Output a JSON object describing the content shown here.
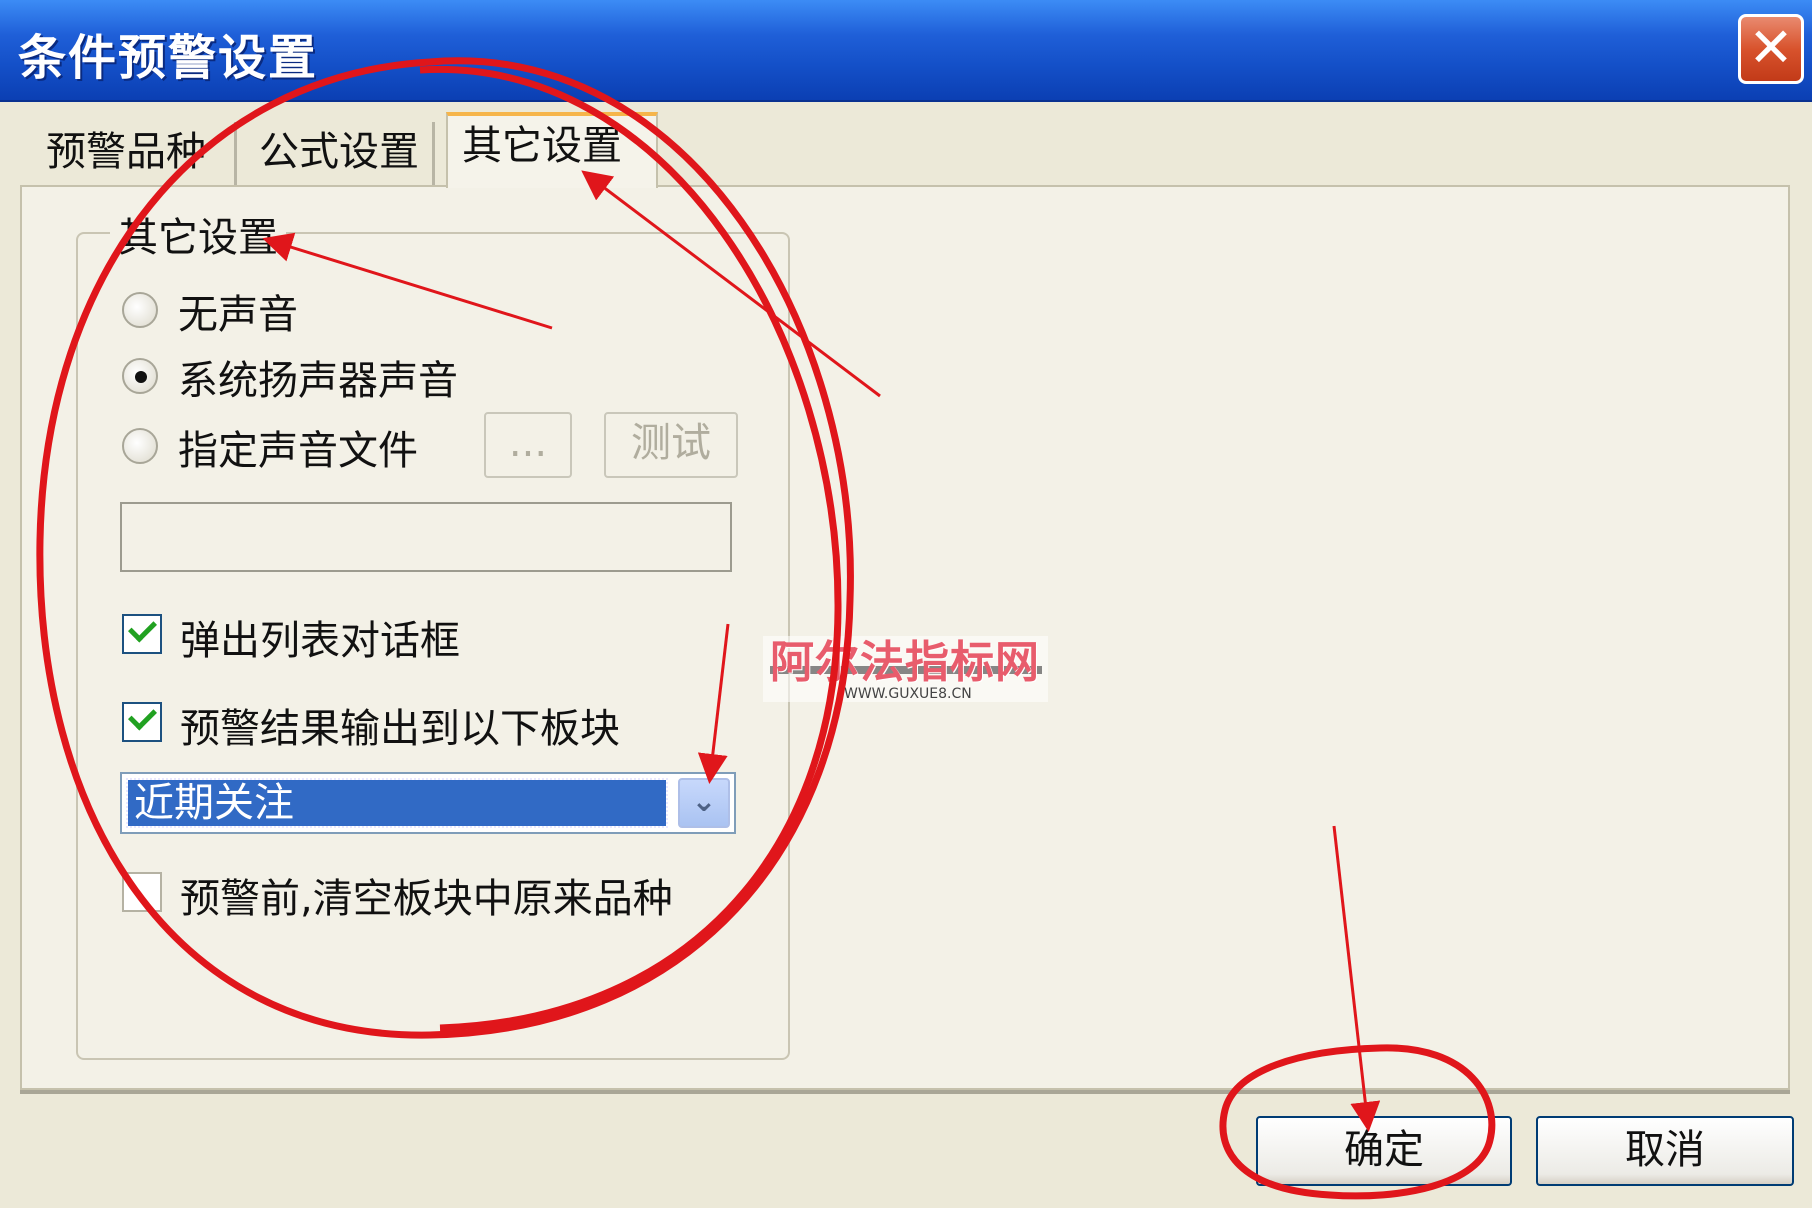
{
  "window": {
    "title": "条件预警设置",
    "close_symbol": "✕"
  },
  "tabs": [
    {
      "label": "预警品种",
      "active": false
    },
    {
      "label": "公式设置",
      "active": false
    },
    {
      "label": "其它设置",
      "active": true
    }
  ],
  "group": {
    "title": "其它设置",
    "sound_options": [
      {
        "label": "无声音",
        "selected": false
      },
      {
        "label": "系统扬声器声音",
        "selected": true
      },
      {
        "label": "指定声音文件",
        "selected": false
      }
    ],
    "browse_label": "...",
    "test_label": "测试",
    "sound_file_value": "",
    "checkbox_popup": {
      "label": "弹出列表对话框",
      "checked": true
    },
    "checkbox_output": {
      "label": "预警结果输出到以下板块",
      "checked": true
    },
    "block_select": {
      "value": "近期关注"
    },
    "checkbox_clear": {
      "label": "预警前,清空板块中原来品种",
      "checked": false
    }
  },
  "footer": {
    "ok_label": "确定",
    "cancel_label": "取消"
  },
  "watermark": {
    "title": "阿尔法指标网",
    "url": "WWW.GUXUE8.CN"
  },
  "annotation_color": "#e0161b"
}
